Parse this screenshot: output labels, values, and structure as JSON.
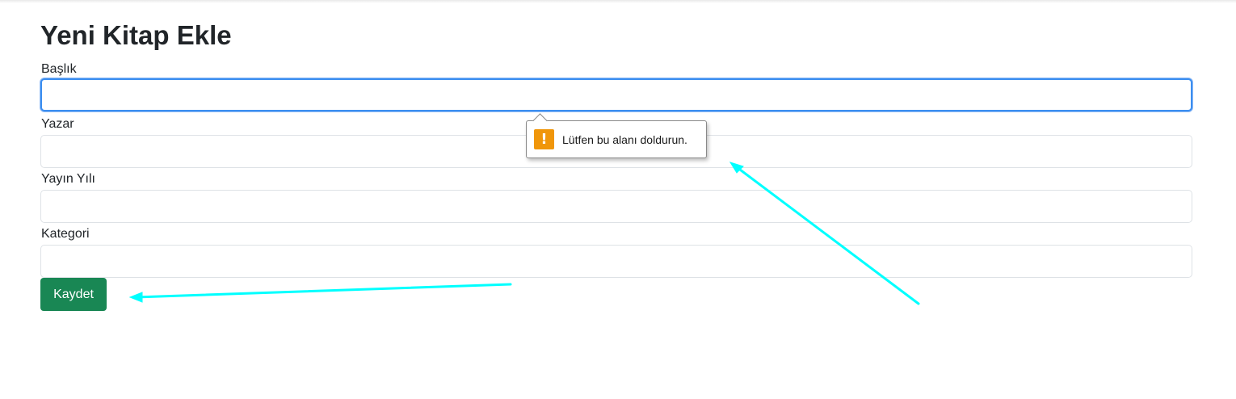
{
  "page": {
    "title": "Yeni Kitap Ekle"
  },
  "form": {
    "fields": [
      {
        "label": "Başlık",
        "value": "",
        "placeholder": ""
      },
      {
        "label": "Yazar",
        "value": "",
        "placeholder": ""
      },
      {
        "label": "Yayın Yılı",
        "value": "",
        "placeholder": ""
      },
      {
        "label": "Kategori",
        "value": "",
        "placeholder": ""
      }
    ],
    "submit_label": "Kaydet"
  },
  "validation_tooltip": {
    "icon": "warning-icon",
    "message": "Lütfen bu alanı doldurun."
  },
  "colors": {
    "submit": "#198754",
    "focus": "#3b8ef0",
    "warning": "#f0960a",
    "annotation_arrow": "#00ffff"
  }
}
